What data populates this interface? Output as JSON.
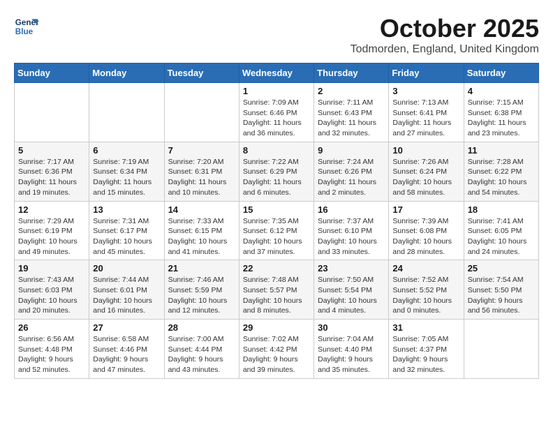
{
  "logo": {
    "line1": "General",
    "line2": "Blue"
  },
  "header": {
    "month_year": "October 2025",
    "location": "Todmorden, England, United Kingdom"
  },
  "weekdays": [
    "Sunday",
    "Monday",
    "Tuesday",
    "Wednesday",
    "Thursday",
    "Friday",
    "Saturday"
  ],
  "weeks": [
    [
      {
        "day": "",
        "info": ""
      },
      {
        "day": "",
        "info": ""
      },
      {
        "day": "",
        "info": ""
      },
      {
        "day": "1",
        "info": "Sunrise: 7:09 AM\nSunset: 6:46 PM\nDaylight: 11 hours\nand 36 minutes."
      },
      {
        "day": "2",
        "info": "Sunrise: 7:11 AM\nSunset: 6:43 PM\nDaylight: 11 hours\nand 32 minutes."
      },
      {
        "day": "3",
        "info": "Sunrise: 7:13 AM\nSunset: 6:41 PM\nDaylight: 11 hours\nand 27 minutes."
      },
      {
        "day": "4",
        "info": "Sunrise: 7:15 AM\nSunset: 6:38 PM\nDaylight: 11 hours\nand 23 minutes."
      }
    ],
    [
      {
        "day": "5",
        "info": "Sunrise: 7:17 AM\nSunset: 6:36 PM\nDaylight: 11 hours\nand 19 minutes."
      },
      {
        "day": "6",
        "info": "Sunrise: 7:19 AM\nSunset: 6:34 PM\nDaylight: 11 hours\nand 15 minutes."
      },
      {
        "day": "7",
        "info": "Sunrise: 7:20 AM\nSunset: 6:31 PM\nDaylight: 11 hours\nand 10 minutes."
      },
      {
        "day": "8",
        "info": "Sunrise: 7:22 AM\nSunset: 6:29 PM\nDaylight: 11 hours\nand 6 minutes."
      },
      {
        "day": "9",
        "info": "Sunrise: 7:24 AM\nSunset: 6:26 PM\nDaylight: 11 hours\nand 2 minutes."
      },
      {
        "day": "10",
        "info": "Sunrise: 7:26 AM\nSunset: 6:24 PM\nDaylight: 10 hours\nand 58 minutes."
      },
      {
        "day": "11",
        "info": "Sunrise: 7:28 AM\nSunset: 6:22 PM\nDaylight: 10 hours\nand 54 minutes."
      }
    ],
    [
      {
        "day": "12",
        "info": "Sunrise: 7:29 AM\nSunset: 6:19 PM\nDaylight: 10 hours\nand 49 minutes."
      },
      {
        "day": "13",
        "info": "Sunrise: 7:31 AM\nSunset: 6:17 PM\nDaylight: 10 hours\nand 45 minutes."
      },
      {
        "day": "14",
        "info": "Sunrise: 7:33 AM\nSunset: 6:15 PM\nDaylight: 10 hours\nand 41 minutes."
      },
      {
        "day": "15",
        "info": "Sunrise: 7:35 AM\nSunset: 6:12 PM\nDaylight: 10 hours\nand 37 minutes."
      },
      {
        "day": "16",
        "info": "Sunrise: 7:37 AM\nSunset: 6:10 PM\nDaylight: 10 hours\nand 33 minutes."
      },
      {
        "day": "17",
        "info": "Sunrise: 7:39 AM\nSunset: 6:08 PM\nDaylight: 10 hours\nand 28 minutes."
      },
      {
        "day": "18",
        "info": "Sunrise: 7:41 AM\nSunset: 6:05 PM\nDaylight: 10 hours\nand 24 minutes."
      }
    ],
    [
      {
        "day": "19",
        "info": "Sunrise: 7:43 AM\nSunset: 6:03 PM\nDaylight: 10 hours\nand 20 minutes."
      },
      {
        "day": "20",
        "info": "Sunrise: 7:44 AM\nSunset: 6:01 PM\nDaylight: 10 hours\nand 16 minutes."
      },
      {
        "day": "21",
        "info": "Sunrise: 7:46 AM\nSunset: 5:59 PM\nDaylight: 10 hours\nand 12 minutes."
      },
      {
        "day": "22",
        "info": "Sunrise: 7:48 AM\nSunset: 5:57 PM\nDaylight: 10 hours\nand 8 minutes."
      },
      {
        "day": "23",
        "info": "Sunrise: 7:50 AM\nSunset: 5:54 PM\nDaylight: 10 hours\nand 4 minutes."
      },
      {
        "day": "24",
        "info": "Sunrise: 7:52 AM\nSunset: 5:52 PM\nDaylight: 10 hours\nand 0 minutes."
      },
      {
        "day": "25",
        "info": "Sunrise: 7:54 AM\nSunset: 5:50 PM\nDaylight: 9 hours\nand 56 minutes."
      }
    ],
    [
      {
        "day": "26",
        "info": "Sunrise: 6:56 AM\nSunset: 4:48 PM\nDaylight: 9 hours\nand 52 minutes."
      },
      {
        "day": "27",
        "info": "Sunrise: 6:58 AM\nSunset: 4:46 PM\nDaylight: 9 hours\nand 47 minutes."
      },
      {
        "day": "28",
        "info": "Sunrise: 7:00 AM\nSunset: 4:44 PM\nDaylight: 9 hours\nand 43 minutes."
      },
      {
        "day": "29",
        "info": "Sunrise: 7:02 AM\nSunset: 4:42 PM\nDaylight: 9 hours\nand 39 minutes."
      },
      {
        "day": "30",
        "info": "Sunrise: 7:04 AM\nSunset: 4:40 PM\nDaylight: 9 hours\nand 35 minutes."
      },
      {
        "day": "31",
        "info": "Sunrise: 7:05 AM\nSunset: 4:37 PM\nDaylight: 9 hours\nand 32 minutes."
      },
      {
        "day": "",
        "info": ""
      }
    ]
  ]
}
